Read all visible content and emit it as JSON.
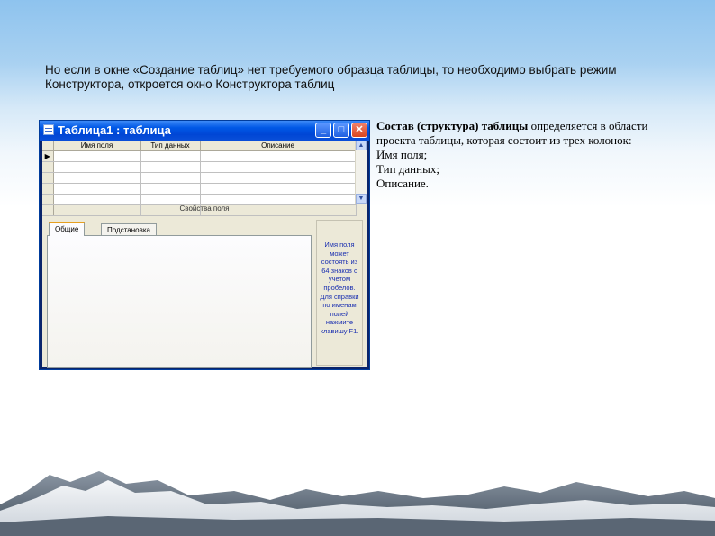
{
  "intro_text": "Но если в окне «Создание таблиц» нет требуемого образца таблицы, то необходимо выбрать режим Конструктора, откроется окно Конструктора таблиц",
  "description": {
    "lead_bold": "Состав (структура) таблицы",
    "lead_rest": " определяется в области проекта таблицы, которая состоит из трех колонок:",
    "items": [
      "Имя поля;",
      "Тип данных;",
      "Описание."
    ]
  },
  "window": {
    "title": "Таблица1 : таблица",
    "buttons": {
      "minimize": "_",
      "maximize": "□",
      "close": "✕"
    },
    "grid": {
      "columns": [
        "Имя поля",
        "Тип данных",
        "Описание"
      ],
      "row_count": 6,
      "current_row_marker": "▶"
    },
    "scroll": {
      "up": "▲",
      "down": "▼"
    },
    "properties_label": "Свойства поля",
    "tabs": [
      {
        "label": "Общие",
        "active": true
      },
      {
        "label": "Подстановка",
        "active": false
      }
    ],
    "hint_text": "Имя поля может состоять из 64 знаков с учетом пробелов. Для справки по именам полей нажмите клавишу F1."
  },
  "colors": {
    "titlebar": "#0058e6",
    "window_face": "#ece9d8",
    "hint_text": "#1a2fb0",
    "tab_highlight": "#e6a020"
  }
}
